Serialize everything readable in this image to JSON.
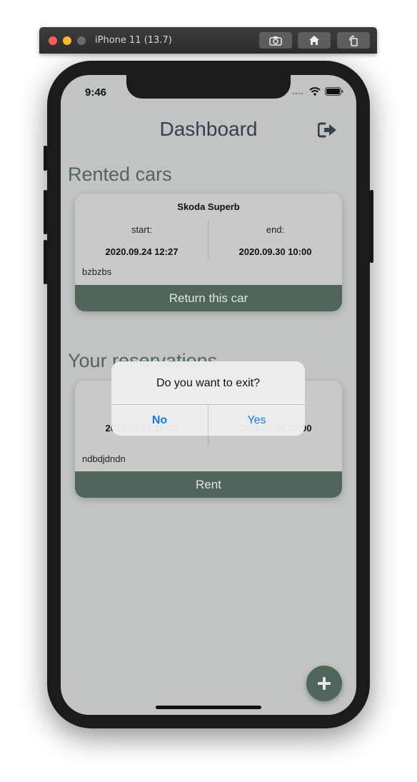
{
  "simulator": {
    "title": "iPhone 11 (13.7)",
    "buttons": [
      "camera-icon",
      "home-icon",
      "rotate-icon"
    ]
  },
  "status_bar": {
    "time": "9:46",
    "icons": [
      "signal-icon",
      "wifi-icon",
      "battery-icon"
    ]
  },
  "header": {
    "title": "Dashboard",
    "logout_icon": "logout-icon"
  },
  "rented": {
    "section_title": "Rented cars",
    "card": {
      "name": "Skoda Superb",
      "start_label": "start:",
      "start_value": "2020.09.24 12:27",
      "end_label": "end:",
      "end_value": "2020.09.30 10:00",
      "note": "bzbzbs",
      "action": "Return this car"
    }
  },
  "reservations": {
    "section_title": "Your reservations",
    "card": {
      "start_value": "2020.09.28 10:00",
      "end_value": "2020.09.30 10:00",
      "note": "ndbdjdndn",
      "action": "Rent"
    }
  },
  "alert": {
    "message": "Do you want to exit?",
    "no": "No",
    "yes": "Yes"
  },
  "fab": {
    "icon": "plus-icon"
  },
  "colors": {
    "accent": "#51665a",
    "background": "#c1c4c3",
    "card": "#c9c9c9",
    "ios_blue": "#0a7aff"
  }
}
